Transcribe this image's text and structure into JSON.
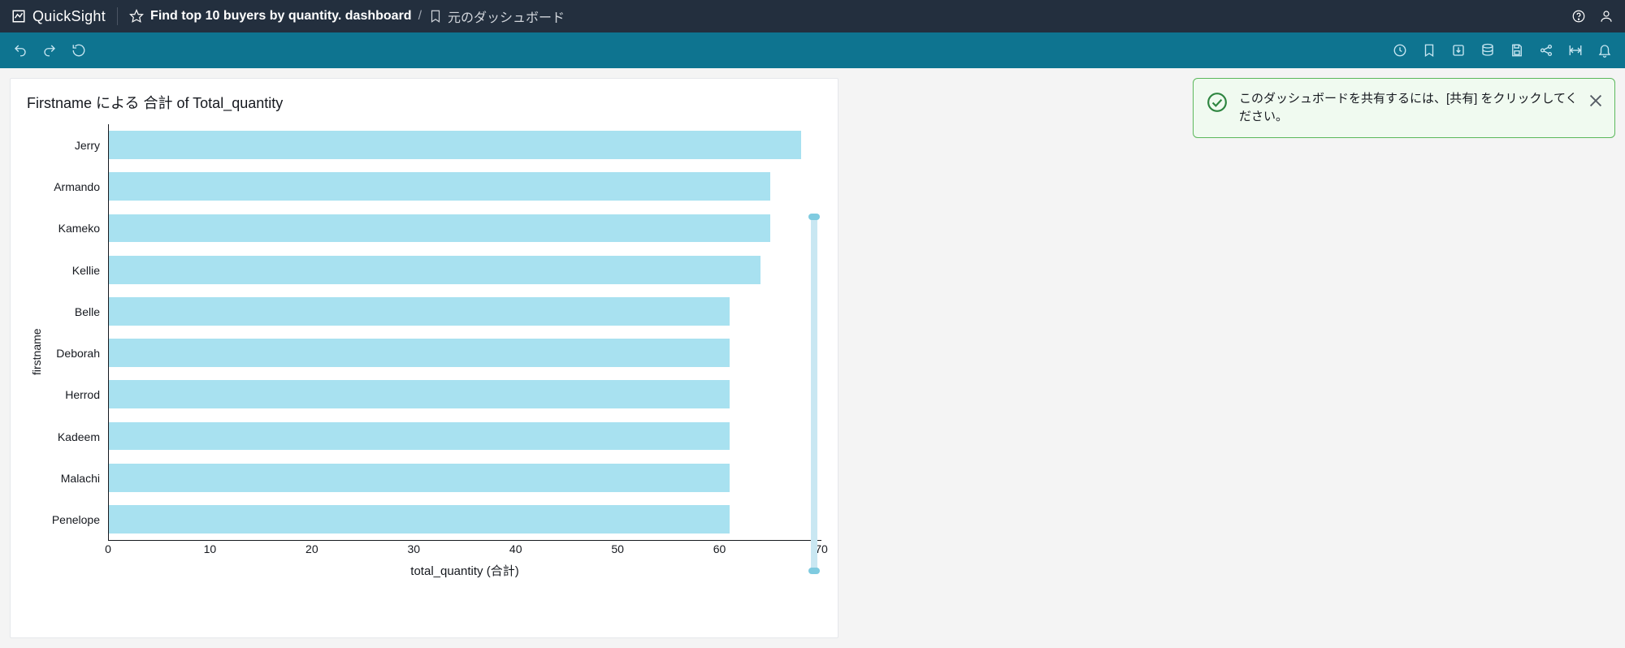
{
  "app": {
    "name": "QuickSight"
  },
  "breadcrumb": {
    "title": "Find top 10 buyers by quantity. dashboard",
    "separator": "/",
    "origin_label": "元のダッシュボード"
  },
  "toolbar_icons": {
    "undo": "undo-icon",
    "redo": "redo-icon",
    "reset": "reset-icon",
    "history": "history-icon",
    "bookmark": "bookmark-icon",
    "export": "export-icon",
    "database": "database-icon",
    "save": "save-icon",
    "share": "share-icon",
    "fit": "fit-width-icon",
    "bell": "bell-icon"
  },
  "visual": {
    "title": "Firstname による 合計 of Total_quantity",
    "ylabel": "firstname",
    "xlabel": "total_quantity (合計)"
  },
  "notification": {
    "message": "このダッシュボードを共有するには、[共有] をクリックしてください。"
  },
  "chart_data": {
    "type": "bar",
    "orientation": "horizontal",
    "title": "Firstname による 合計 of Total_quantity",
    "xlabel": "total_quantity (合計)",
    "ylabel": "firstname",
    "xlim": [
      0,
      70
    ],
    "xticks": [
      0,
      10,
      20,
      30,
      40,
      50,
      60,
      70
    ],
    "categories": [
      "Jerry",
      "Armando",
      "Kameko",
      "Kellie",
      "Belle",
      "Deborah",
      "Herrod",
      "Kadeem",
      "Malachi",
      "Penelope"
    ],
    "values": [
      68,
      65,
      65,
      64,
      61,
      61,
      61,
      61,
      61,
      61
    ]
  }
}
